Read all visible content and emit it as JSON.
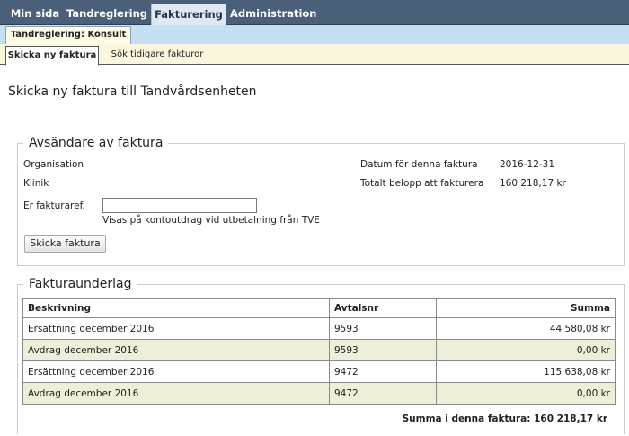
{
  "topnav": {
    "tabs": [
      {
        "label": "Min sida"
      },
      {
        "label": "Tandreglering"
      },
      {
        "label": "Fakturering"
      },
      {
        "label": "Administration"
      }
    ]
  },
  "subnav": {
    "label": "Tandreglering: Konsult"
  },
  "tabs": {
    "send": "Skicka ny faktura",
    "search": "Sök tidigare fakturor"
  },
  "page": {
    "title": "Skicka ny faktura till Tandvårdsenheten"
  },
  "sender": {
    "legend": "Avsändare av faktura",
    "organisation_label": "Organisation",
    "klinik_label": "Klinik",
    "ref_label": "Er fakturaref.",
    "ref_value": "",
    "ref_help": "Visas på kontoutdrag vid utbetalning från TVE",
    "date_label": "Datum för denna faktura",
    "date_value": "2016-12-31",
    "total_label": "Totalt belopp att fakturera",
    "total_value": "160 218,17 kr",
    "send_button": "Skicka faktura"
  },
  "basis": {
    "legend": "Fakturaunderlag",
    "columns": [
      "Beskrivning",
      "Avtalsnr",
      "Summa"
    ],
    "rows": [
      [
        "Ersättning december 2016",
        "9593",
        "44 580,08 kr"
      ],
      [
        "Avdrag december 2016",
        "9593",
        "0,00 kr"
      ],
      [
        "Ersättning december 2016",
        "9472",
        "115 638,08 kr"
      ],
      [
        "Avdrag december 2016",
        "9472",
        "0,00 kr"
      ]
    ],
    "sum_text": "Summa i denna faktura: 160 218,17 kr"
  },
  "colors": {
    "nav": "#4a5f78",
    "subnav": "#c5dff3",
    "row_alt": "#efefd9"
  }
}
